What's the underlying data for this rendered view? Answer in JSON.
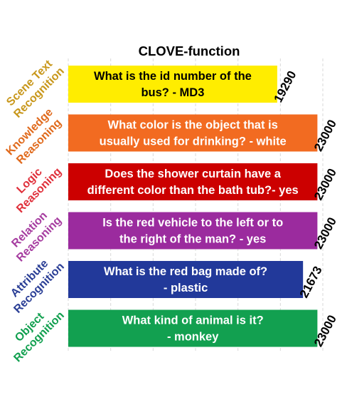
{
  "chart_data": {
    "type": "bar",
    "orientation": "horizontal",
    "title": "CLOVE-function",
    "xlim": [
      0,
      23500
    ],
    "grid": true,
    "categories": [
      "Scene Text Recognition",
      "Knowledge Reasoning",
      "Logic Reasoning",
      "Relation Reasoning",
      "Attribute Recognition",
      "Object Recognition"
    ],
    "category_lines": [
      [
        "Scene Text",
        "Recognition"
      ],
      [
        "Knowledge",
        "Reasoning"
      ],
      [
        "Logic",
        "Reasoning"
      ],
      [
        "Relation",
        "Reasoning"
      ],
      [
        "Attribute",
        "Recognition"
      ],
      [
        "Object",
        "Recognition"
      ]
    ],
    "values": [
      19290,
      23000,
      23000,
      23000,
      21673,
      23000
    ],
    "bar_text": [
      [
        "What is the id number of the",
        "bus? - MD3"
      ],
      [
        "What color is the object that is",
        "usually used for drinking? - white"
      ],
      [
        "Does the shower curtain have a",
        "different color than the bath tub?- yes"
      ],
      [
        "Is the red vehicle to the left or to",
        "the right of the man? - yes"
      ],
      [
        "What is the red bag made of?",
        "- plastic"
      ],
      [
        "What kind of animal is it?",
        "- monkey"
      ]
    ],
    "colors": [
      "#FFED00",
      "#F26B21",
      "#CC0000",
      "#9B2B9E",
      "#22399A",
      "#12A050"
    ],
    "label_colors": [
      "#C8971B",
      "#E06A1C",
      "#E0303B",
      "#A63DA0",
      "#2B3F96",
      "#12A050"
    ],
    "bar_text_colors": [
      "#000000",
      "#FFFFFF",
      "#FFFFFF",
      "#FFFFFF",
      "#FFFFFF",
      "#FFFFFF"
    ]
  }
}
